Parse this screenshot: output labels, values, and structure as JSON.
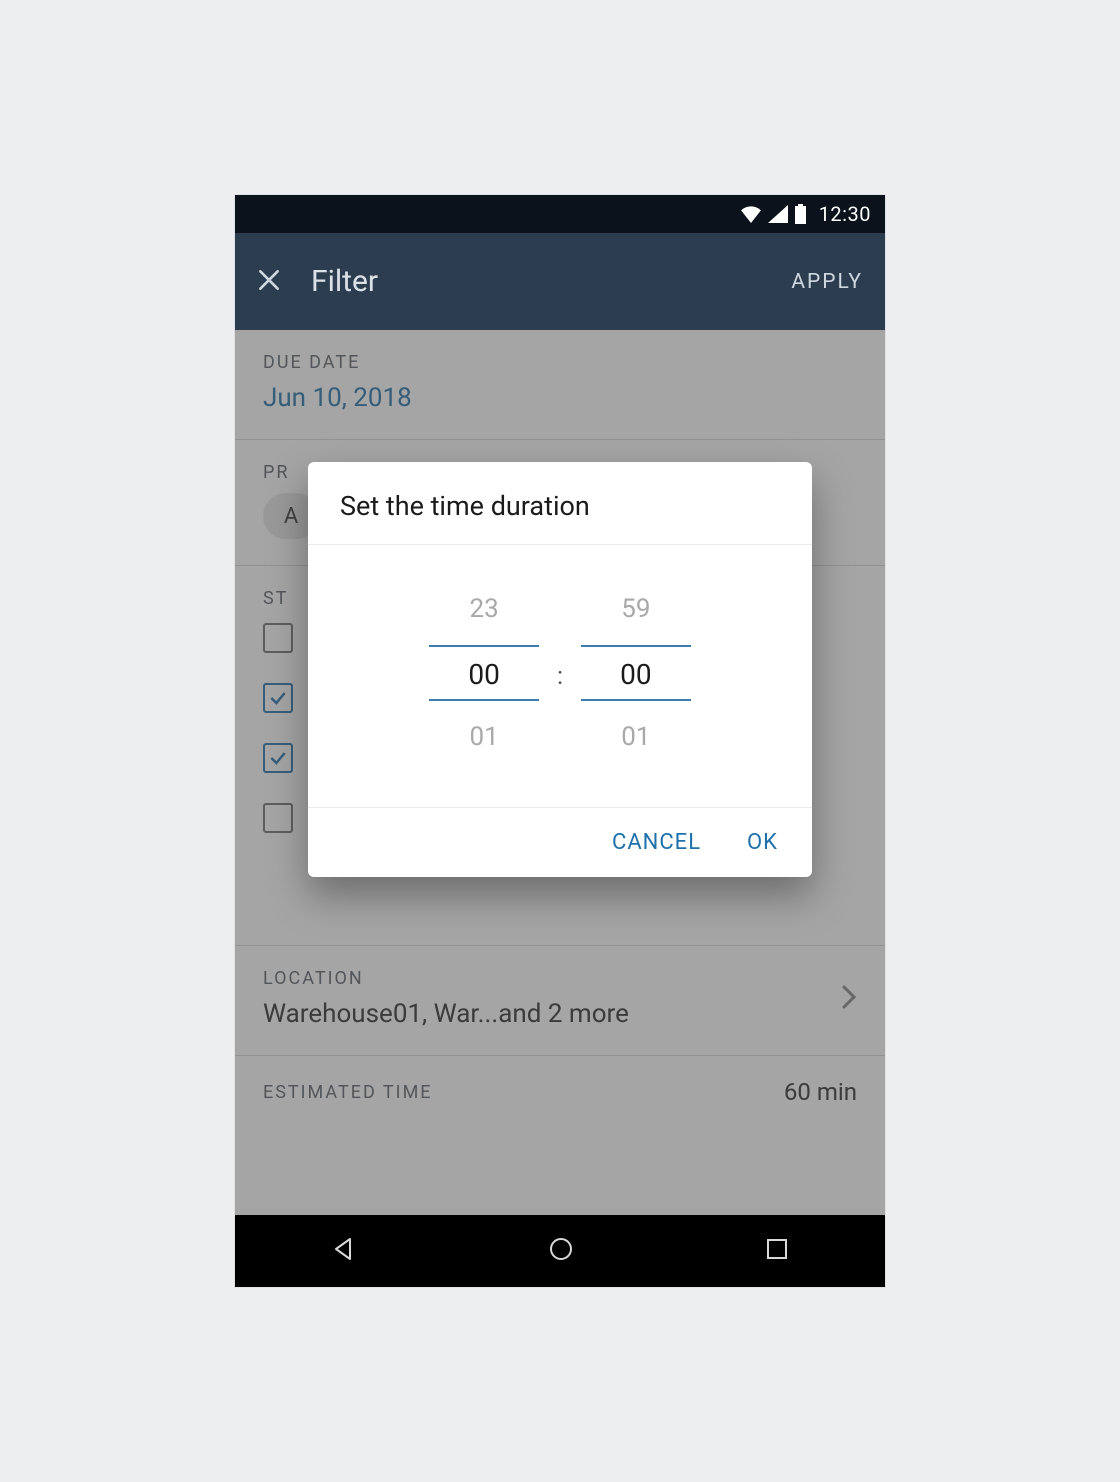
{
  "status_bar": {
    "time": "12:30"
  },
  "app_bar": {
    "title": "Filter",
    "apply": "APPLY"
  },
  "sections": {
    "due_date": {
      "label": "DUE DATE",
      "value": "Jun 10, 2018"
    },
    "priority": {
      "label": "PR",
      "chip": "A"
    },
    "status": {
      "label": "ST",
      "items": [
        {
          "checked": false
        },
        {
          "checked": true
        },
        {
          "checked": true
        },
        {
          "checked": false
        }
      ]
    },
    "location": {
      "label": "LOCATION",
      "value": "Warehouse01, War...and 2 more"
    },
    "estimated_time": {
      "label": "ESTIMATED TIME",
      "value": "60 min"
    }
  },
  "dialog": {
    "title": "Set the time duration",
    "hours": {
      "prev": "23",
      "current": "00",
      "next": "01"
    },
    "minutes": {
      "prev": "59",
      "current": "00",
      "next": "01"
    },
    "separator": ":",
    "cancel": "CANCEL",
    "ok": "OK"
  }
}
